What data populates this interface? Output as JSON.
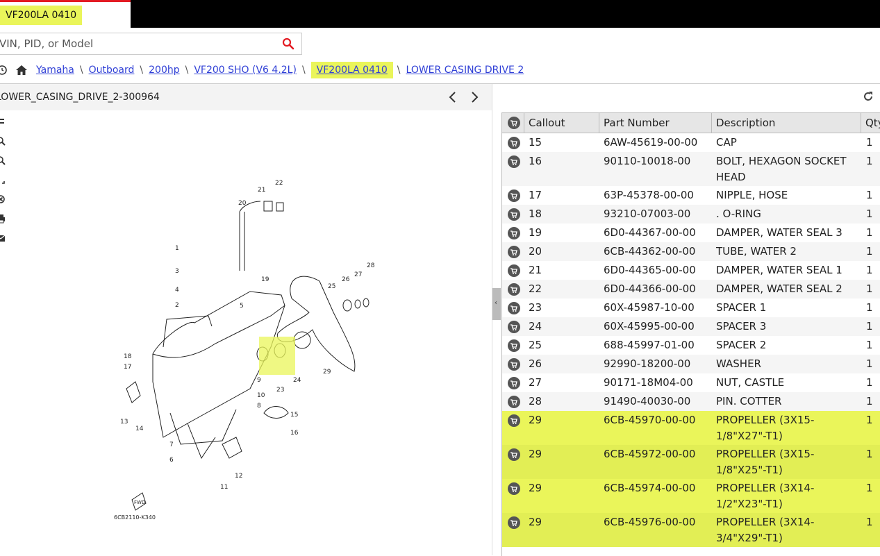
{
  "tab": {
    "label": "VF200LA 0410"
  },
  "search": {
    "placeholder": "VIN, PID, or Model"
  },
  "breadcrumb": {
    "items": [
      "Yamaha",
      "Outboard",
      "200hp",
      "VF200 SHO (V6 4.2L)",
      "VF200LA 0410",
      "LOWER CASING DRIVE 2"
    ],
    "separator": "\\"
  },
  "diagram": {
    "title": "LOWER_CASING_DRIVE_2-300964",
    "code": "6CB2110-K340",
    "fwd": "FWD",
    "callouts": [
      "1",
      "2",
      "3",
      "4",
      "5",
      "6",
      "7",
      "8",
      "9",
      "10",
      "11",
      "12",
      "13",
      "14",
      "15",
      "16",
      "17",
      "18",
      "19",
      "20",
      "21",
      "22",
      "23",
      "24",
      "25",
      "26",
      "27",
      "28",
      "29"
    ]
  },
  "table": {
    "headers": [
      "Callout",
      "Part Number",
      "Description",
      "Qty"
    ],
    "partial_top": "HEAD",
    "rows": [
      {
        "callout": "15",
        "part": "6AW-45619-00-00",
        "desc": "CAP",
        "qty": "1",
        "lines": 1
      },
      {
        "callout": "16",
        "part": "90110-10018-00",
        "desc": "BOLT, HEXAGON SOCKET HEAD",
        "qty": "1",
        "lines": 2
      },
      {
        "callout": "17",
        "part": "63P-45378-00-00",
        "desc": "NIPPLE, HOSE",
        "qty": "1",
        "lines": 1
      },
      {
        "callout": "18",
        "part": "93210-07003-00",
        "desc": ". O-RING",
        "qty": "1",
        "lines": 1
      },
      {
        "callout": "19",
        "part": "6D0-44367-00-00",
        "desc": "DAMPER, WATER SEAL 3",
        "qty": "1",
        "lines": 1
      },
      {
        "callout": "20",
        "part": "6CB-44362-00-00",
        "desc": "TUBE, WATER 2",
        "qty": "1",
        "lines": 1
      },
      {
        "callout": "21",
        "part": "6D0-44365-00-00",
        "desc": "DAMPER, WATER SEAL 1",
        "qty": "1",
        "lines": 1
      },
      {
        "callout": "22",
        "part": "6D0-44366-00-00",
        "desc": "DAMPER, WATER SEAL 2",
        "qty": "1",
        "lines": 1
      },
      {
        "callout": "23",
        "part": "60X-45987-10-00",
        "desc": "SPACER 1",
        "qty": "1",
        "lines": 1
      },
      {
        "callout": "24",
        "part": "60X-45995-00-00",
        "desc": "SPACER 3",
        "qty": "1",
        "lines": 1
      },
      {
        "callout": "25",
        "part": "688-45997-01-00",
        "desc": "SPACER 2",
        "qty": "1",
        "lines": 1
      },
      {
        "callout": "26",
        "part": "92990-18200-00",
        "desc": "WASHER",
        "qty": "1",
        "lines": 1
      },
      {
        "callout": "27",
        "part": "90171-18M04-00",
        "desc": "NUT, CASTLE",
        "qty": "1",
        "lines": 1
      },
      {
        "callout": "28",
        "part": "91490-40030-00",
        "desc": "PIN. COTTER",
        "qty": "1",
        "lines": 1
      },
      {
        "callout": "29",
        "part": "6CB-45970-00-00",
        "desc": "PROPELLER (3X15-1/8\"X27\"-T1)",
        "qty": "1",
        "lines": 2,
        "highlight": true
      },
      {
        "callout": "29",
        "part": "6CB-45972-00-00",
        "desc": "PROPELLER (3X15-1/8\"X25\"-T1)",
        "qty": "1",
        "lines": 2,
        "highlight": true
      },
      {
        "callout": "29",
        "part": "6CB-45974-00-00",
        "desc": "PROPELLER (3X14-1/2\"X23\"-T1)",
        "qty": "1",
        "lines": 2,
        "highlight": true
      },
      {
        "callout": "29",
        "part": "6CB-45976-00-00",
        "desc": "PROPELLER (3X14-3/4\"X29\"-T1)",
        "qty": "1",
        "lines": 2,
        "highlight": true
      }
    ]
  },
  "colors": {
    "accent": "#e31b23",
    "highlight": "#eaf55a",
    "link": "#2f3fd6"
  },
  "icons": [
    "search-icon",
    "history-icon",
    "home-icon",
    "chevron-left-icon",
    "chevron-right-icon",
    "refresh-icon",
    "cart-icon",
    "menu-icon",
    "zoom-in-icon",
    "zoom-out-icon",
    "fit-icon",
    "reset-icon",
    "print-icon",
    "email-icon"
  ]
}
